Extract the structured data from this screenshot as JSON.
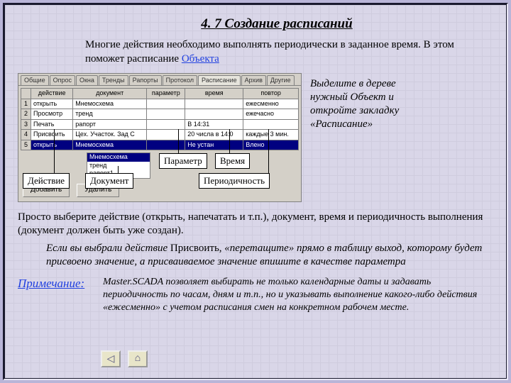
{
  "heading": "4. 7 Создание расписаний",
  "intro_plain": "Многие действия необходимо выполнять периодически в заданное время. В этом поможет расписание ",
  "intro_link": "Объекта",
  "tabs": [
    "Общие",
    "Опрос",
    "Окна",
    "Тренды",
    "Рапорты",
    "Протокол",
    "Расписание",
    "Архив",
    "Другие"
  ],
  "grid": {
    "headers": [
      "",
      "действие",
      "документ",
      "параметр",
      "время",
      "повтор"
    ],
    "rows": [
      [
        "1",
        "открыть",
        "Мнемосхема",
        "",
        "",
        "ежесменно"
      ],
      [
        "2",
        "Просмотр",
        "тренд",
        "",
        "",
        "ежечасно"
      ],
      [
        "3",
        "Печать",
        "рапорт",
        "",
        "В 14:31",
        ""
      ],
      [
        "4",
        "Присвоить",
        "Цех. Участок. Зад С",
        "",
        "20 числа в 14:0",
        "каждые 3 мин."
      ],
      [
        "5",
        "открыть",
        "Мнемосхема",
        "",
        "Не устан",
        "Влено"
      ]
    ]
  },
  "dropdown": {
    "selected": "Мнемосхема",
    "items": [
      "тренд",
      "рапорт1"
    ]
  },
  "buttons": {
    "add": "Добавить",
    "del": "Удалить"
  },
  "callouts": {
    "action": "Действие",
    "document": "Документ",
    "param": "Параметр",
    "time": "Время",
    "period": "Периодичность"
  },
  "side_note": "Выделите в дереве нужный Объект и откройте закладку «Расписание»",
  "para1": "Просто выберите действие (открыть, напечатать и  т.п.), документ, время и периодичность выполнения (документ должен быть уже создан).",
  "para2_a": "Если вы выбрали действие",
  "para2_b": " Присвоить, ",
  "para2_c": "«перетащите» прямо в таблицу выход, которому будет присвоено значение, а присваиваемое значение впишите в качестве параметра",
  "note_label": "Примечание:",
  "note_body": "Master.SCADA позволяет выбирать не только календарные даты и задавать периодичность по часам, дням и т.п., но и указывать выполнение какого-либо действия «ежесменно» с учетом расписания смен на конкретном рабочем месте.",
  "nav": {
    "back": "◁",
    "home": "⌂"
  }
}
